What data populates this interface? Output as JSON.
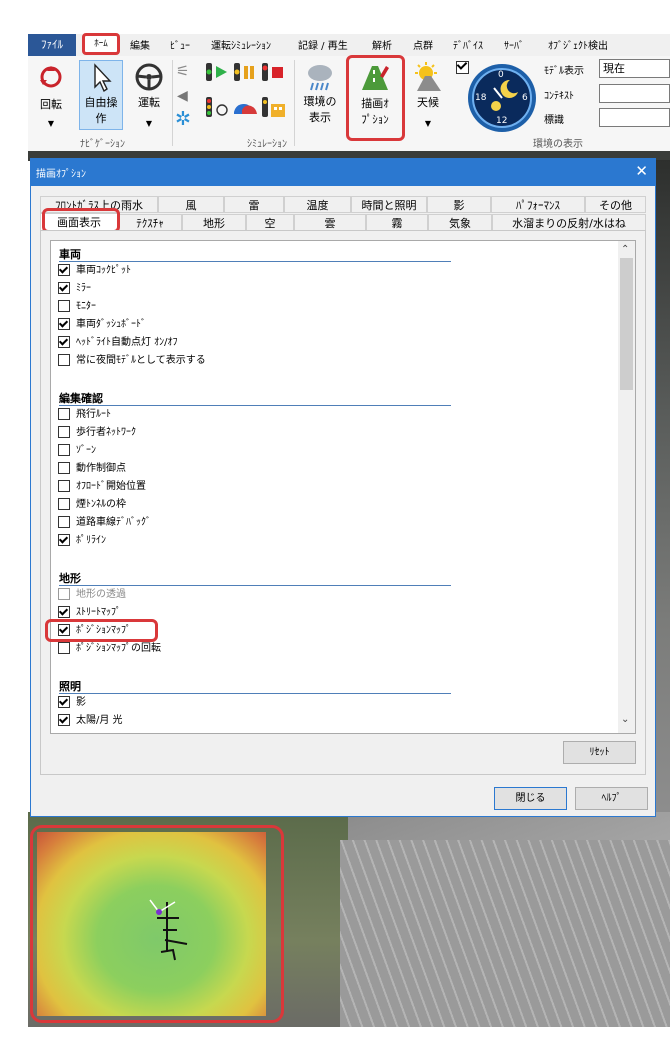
{
  "ribbon": {
    "tabs": [
      "ﾌｧｲﾙ",
      "ﾎｰﾑ",
      "編集",
      "ﾋﾞｭｰ",
      "運転ｼﾐｭﾚｰｼｮﾝ",
      "記録 / 再生",
      "解析",
      "点群",
      "ﾃﾞﾊﾞｲｽ",
      "ｻｰﾊﾞ",
      "ｵﾌﾞｼﾞｪｸﾄ検出"
    ],
    "buttons": {
      "rotate": "回転",
      "free_op_1": "自由操",
      "free_op_2": "作",
      "drive": "運転",
      "env_display_1": "環境の",
      "env_display_2": "表示",
      "render_opt_1": "描画ｵ",
      "render_opt_2": "ﾌﾟｼｮﾝ",
      "weather": "天候"
    },
    "groups": {
      "navigation": "ﾅﾋﾞｹﾞｰｼｮﾝ",
      "simulation": "ｼﾐｭﾚｰｼｮﾝ",
      "env_display": "環境の表示"
    },
    "side": {
      "model_display_label": "ﾓﾃﾞﾙ表示",
      "model_display_value": "現在",
      "context_label": "ｺﾝﾃｷｽﾄ",
      "sign_label": "標識"
    },
    "clock": {
      "top": "0",
      "left": "18",
      "right": "6",
      "bottom": "12"
    }
  },
  "dialog": {
    "title": "描画ｵﾌﾟｼｮﾝ",
    "close": "✕",
    "tabs_row1": [
      "ﾌﾛﾝﾄｶﾞﾗｽ上の雨水",
      "風",
      "雷",
      "温度",
      "時間と照明",
      "影",
      "ﾊﾟﾌｫｰﾏﾝｽ",
      "その他"
    ],
    "tabs_row2": [
      "画面表示",
      "ﾃｸｽﾁｬ",
      "地形",
      "空",
      "雲",
      "霧",
      "気象",
      "水溜まりの反射/水はね"
    ],
    "sections": {
      "vehicle": {
        "title": "車両",
        "items": [
          {
            "label": "車両ｺｯｸﾋﾟｯﾄ",
            "checked": true
          },
          {
            "label": "ﾐﾗｰ",
            "checked": true
          },
          {
            "label": "ﾓﾆﾀｰ",
            "checked": false
          },
          {
            "label": "車両ﾀﾞｯｼｭﾎﾞｰﾄﾞ",
            "checked": true
          },
          {
            "label": "ﾍｯﾄﾞﾗｲﾄ自動点灯 ｵﾝ/ｵﾌ",
            "checked": true
          },
          {
            "label": "常に夜間ﾓﾃﾞﾙとして表示する",
            "checked": false
          }
        ]
      },
      "edit_check": {
        "title": "編集確認",
        "items": [
          {
            "label": "飛行ﾙｰﾄ",
            "checked": false
          },
          {
            "label": "歩行者ﾈｯﾄﾜｰｸ",
            "checked": false
          },
          {
            "label": "ｿﾞｰﾝ",
            "checked": false
          },
          {
            "label": "動作制御点",
            "checked": false
          },
          {
            "label": "ｵﾌﾛｰﾄﾞ開始位置",
            "checked": false
          },
          {
            "label": "煙ﾄﾝﾈﾙの枠",
            "checked": false
          },
          {
            "label": "道路車線ﾃﾞﾊﾞｯｸﾞ",
            "checked": false
          },
          {
            "label": "ﾎﾟﾘﾗｲﾝ",
            "checked": true
          }
        ]
      },
      "terrain": {
        "title": "地形",
        "items": [
          {
            "label": "地形の透過",
            "checked": false,
            "disabled": true
          },
          {
            "label": "ｽﾄﾘｰﾄﾏｯﾌﾟ",
            "checked": true
          },
          {
            "label": "ﾎﾟｼﾞｼｮﾝﾏｯﾌﾟ",
            "checked": true
          },
          {
            "label": "ﾎﾟｼﾞｼｮﾝﾏｯﾌﾟの回転",
            "checked": false
          }
        ]
      },
      "lighting": {
        "title": "照明",
        "items": [
          {
            "label": "影",
            "checked": true
          },
          {
            "label": "太陽/月 光",
            "checked": true
          }
        ]
      }
    },
    "reset": "ﾘｾｯﾄ",
    "close_btn": "閉じる",
    "help": "ﾍﾙﾌﾟ"
  },
  "colors": {
    "accent": "#2b78d0",
    "highlight": "#d9383a",
    "file_tab": "#2b5797"
  }
}
